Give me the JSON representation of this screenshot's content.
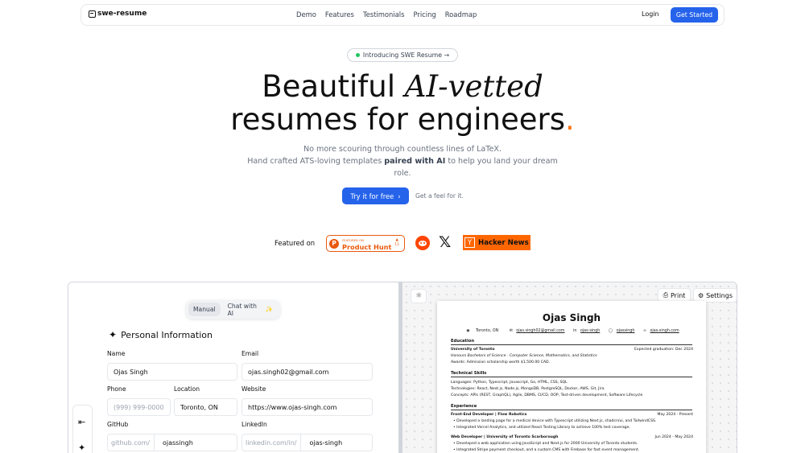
{
  "nav": {
    "brand": "swe-resume",
    "links": [
      "Demo",
      "Features",
      "Testimonials",
      "Pricing",
      "Roadmap"
    ],
    "login": "Login",
    "get_started": "Get Started"
  },
  "hero": {
    "badge": "Introducing SWE Resume →",
    "title_part1": "Beautiful ",
    "title_ai": "AI-vetted",
    "title_line2": "resumes for engineers",
    "title_dot": ".",
    "subtitle_1": "No more scouring through countless lines of LaTeX.",
    "subtitle_2a": "Hand crafted ATS-loving templates ",
    "subtitle_2b": "paired with AI",
    "subtitle_2c": " to help you land your dream role.",
    "try_button": "Try it for free",
    "feel": "Get a feel for it."
  },
  "featured": {
    "label": "Featured on",
    "ph_small": "FEATURED ON",
    "ph_name": "Product Hunt",
    "ph_votes": "11",
    "hn_label": "Hacker News"
  },
  "editor": {
    "modes": [
      "Manual",
      "Chat with AI"
    ],
    "section": "Personal Information",
    "fields": {
      "name_label": "Name",
      "name_value": "Ojas Singh",
      "email_label": "Email",
      "email_value": "ojas.singh02@gmail.com",
      "phone_label": "Phone",
      "phone_placeholder": "(999) 999-0000",
      "location_label": "Location",
      "location_value": "Toronto, ON",
      "website_label": "Website",
      "website_value": "https://www.ojas-singh.com",
      "github_label": "GitHub",
      "github_prefix": "github.com/",
      "github_value": "ojassingh",
      "linkedin_label": "LinkedIn",
      "linkedin_prefix": "linkedin.com/in/",
      "linkedin_value": "ojas-singh"
    }
  },
  "preview": {
    "print": "Print",
    "settings": "Settings",
    "resume": {
      "name": "Ojas Singh",
      "contact": [
        "Toronto, ON",
        "ojas.singh02@gmail.com",
        "ojas-singh",
        "ojassingh",
        "ojas-singh.com"
      ],
      "education_title": "Education",
      "school": "University of Toronto",
      "grad": "Expected graduation: Dec 2024",
      "degree": "Honours Bachelors of Science - Computer Science, Mathematics, and Statistics",
      "awards": "Awards: Admission scholarship worth $1,500.00 CAD.",
      "skills_title": "Technical Skills",
      "languages": "Languages: Python, Typescript, Javascript, Go, HTML, CSS, SQL",
      "technologies": "Technologies: React, Next.js, Node.js, MongoDB, PostgreSQL, Docker, AWS, Git, Jira",
      "concepts": "Concepts: APIs (REST, GraphQL), Agile, DBMS, CI/CD, OOP, Test-driven development, Software Lifecycle",
      "experience_title": "Experience",
      "job1_title": "Front-End Developer | Flow Robotics",
      "job1_date": "May 2024 - Present",
      "job1_b1": "•  Developed a landing page for a medical device with Typescript utilizing Next.js, shadcn/ui, and TailwindCSS.",
      "job1_b2": "•  Integrated Vercel Analytics, and utilized React Testing Library to achieve 100% test coverage.",
      "job2_title": "Web Developer | University of Toronto Scarborough",
      "job2_date": "Jun 2024 - May 2024",
      "job2_b1": "•  Developed a web application using JavaScript and Next.js for 2000 University of Toronto students.",
      "job2_b2": "•  Integrated Stripe payment checkout, and a custom CMS with Firebase for fast event management."
    }
  }
}
